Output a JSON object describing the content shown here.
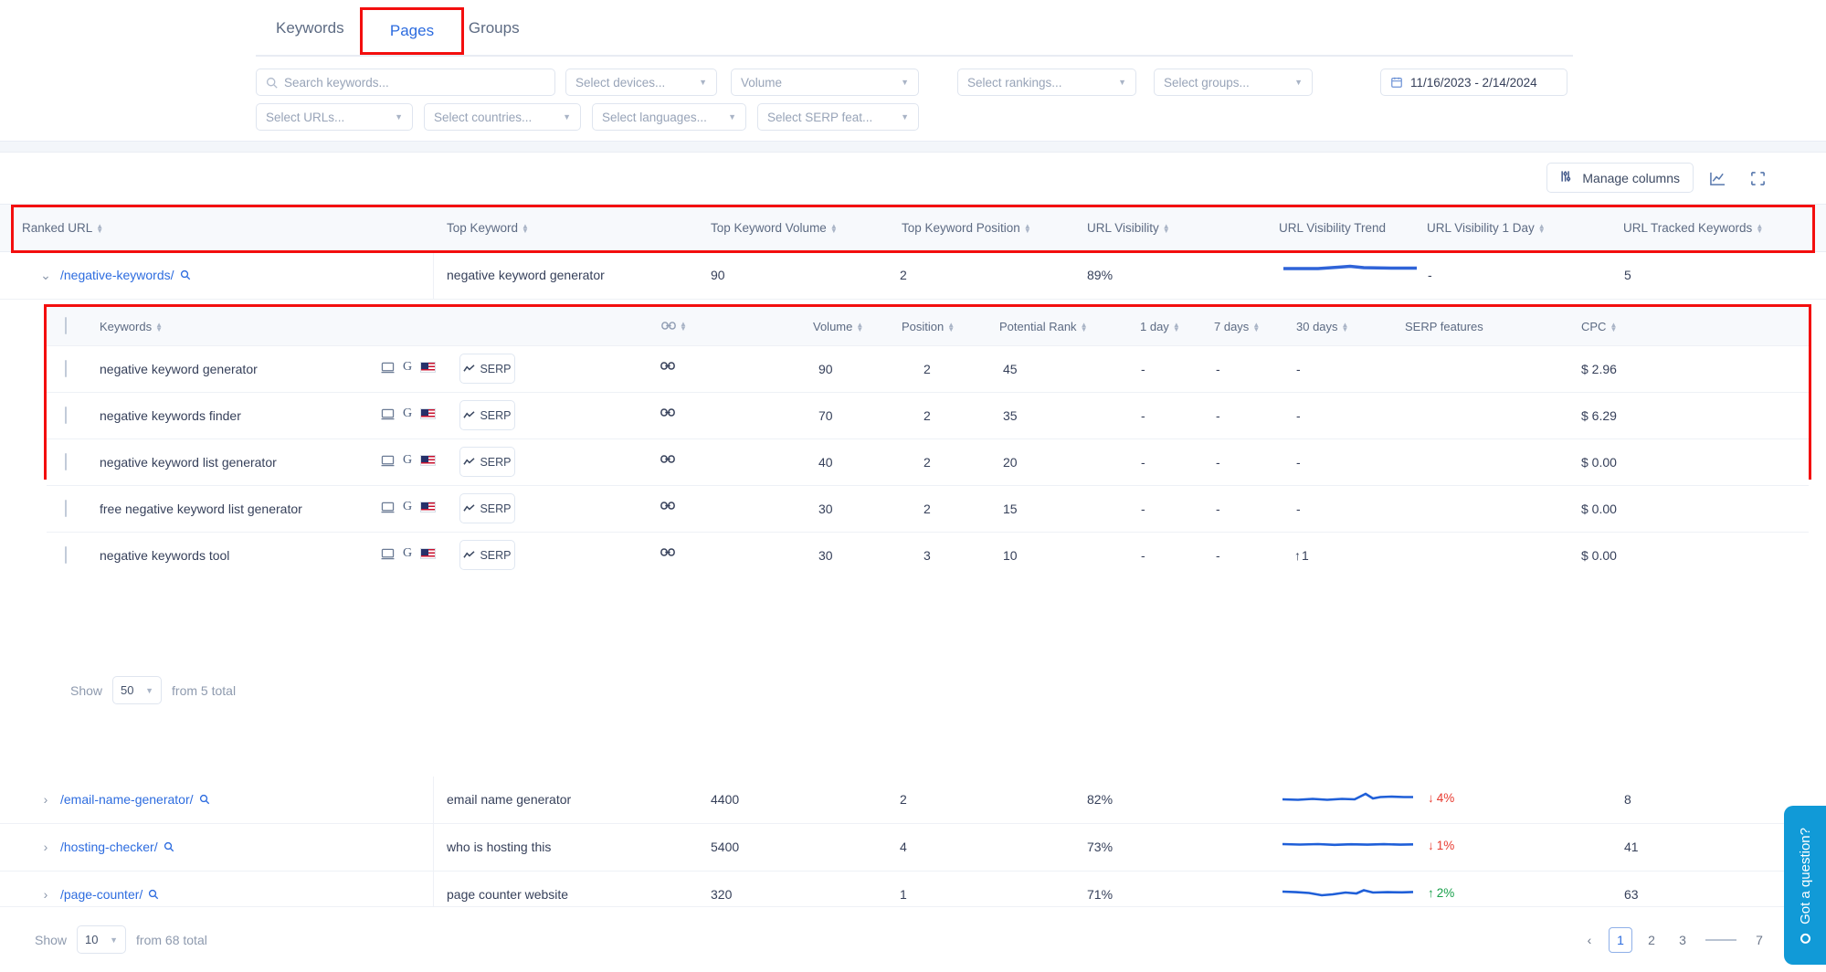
{
  "tabs": [
    {
      "label": "Keywords",
      "active": false
    },
    {
      "label": "Pages",
      "active": true
    },
    {
      "label": "Groups",
      "active": false
    }
  ],
  "filters": {
    "search_placeholder": "Search keywords...",
    "devices": "Select devices...",
    "volume": "Volume",
    "rankings": "Select rankings...",
    "groups": "Select groups...",
    "date_range": "11/16/2023 - 2/14/2024",
    "urls": "Select URLs...",
    "countries": "Select countries...",
    "languages": "Select languages...",
    "serp_features": "Select SERP feat..."
  },
  "toolbar": {
    "manage_columns": "Manage columns"
  },
  "outer_table": {
    "columns": [
      "Ranked URL",
      "Top Keyword",
      "Top Keyword Volume",
      "Top Keyword Position",
      "URL Visibility",
      "URL Visibility Trend",
      "URL Visibility 1 Day",
      "URL Tracked Keywords"
    ],
    "rows": [
      {
        "url": "/negative-keywords/",
        "top_keyword": "negative keyword generator",
        "volume": "90",
        "position": "2",
        "visibility": "89%",
        "visibility_1day": "-",
        "tracked_keywords": "5",
        "expanded": true
      },
      {
        "url": "/email-name-generator/",
        "top_keyword": "email name generator",
        "volume": "4400",
        "position": "2",
        "visibility": "82%",
        "visibility_1day": "4%",
        "trend_dir": "down",
        "tracked_keywords": "8",
        "expanded": false
      },
      {
        "url": "/hosting-checker/",
        "top_keyword": "who is hosting this",
        "volume": "5400",
        "position": "4",
        "visibility": "73%",
        "visibility_1day": "1%",
        "trend_dir": "down",
        "tracked_keywords": "41",
        "expanded": false
      },
      {
        "url": "/page-counter/",
        "top_keyword": "page counter website",
        "volume": "320",
        "position": "1",
        "visibility": "71%",
        "visibility_1day": "2%",
        "trend_dir": "up",
        "tracked_keywords": "63",
        "expanded": false
      }
    ]
  },
  "nested_table": {
    "columns": [
      "Keywords",
      "link",
      "Volume",
      "Position",
      "Potential Rank",
      "1 day",
      "7 days",
      "30 days",
      "SERP features",
      "CPC"
    ],
    "serp_button_label": "SERP",
    "rows": [
      {
        "keyword": "negative keyword generator",
        "volume": "90",
        "position": "2",
        "potential_rank": "45",
        "d1": "-",
        "d7": "-",
        "d30": "-",
        "d30_dir": "none",
        "serp_features": "",
        "cpc": "$ 2.96"
      },
      {
        "keyword": "negative keywords finder",
        "volume": "70",
        "position": "2",
        "potential_rank": "35",
        "d1": "-",
        "d7": "-",
        "d30": "-",
        "d30_dir": "none",
        "serp_features": "",
        "cpc": "$ 6.29"
      },
      {
        "keyword": "negative keyword list generator",
        "volume": "40",
        "position": "2",
        "potential_rank": "20",
        "d1": "-",
        "d7": "-",
        "d30": "-",
        "d30_dir": "none",
        "serp_features": "",
        "cpc": "$ 0.00"
      },
      {
        "keyword": "free negative keyword list generator",
        "volume": "30",
        "position": "2",
        "potential_rank": "15",
        "d1": "-",
        "d7": "-",
        "d30": "-",
        "d30_dir": "none",
        "serp_features": "",
        "cpc": "$ 0.00"
      },
      {
        "keyword": "negative keywords tool",
        "volume": "30",
        "position": "3",
        "potential_rank": "10",
        "d1": "-",
        "d7": "-",
        "d30": "1",
        "d30_dir": "up",
        "serp_features": "",
        "cpc": "$ 0.00"
      }
    ],
    "footer": {
      "show_label": "Show",
      "page_size": "50",
      "total_label": "from 5 total"
    }
  },
  "footer": {
    "show_label": "Show",
    "page_size": "10",
    "total_label": "from 68 total",
    "pages": [
      "1",
      "2",
      "3",
      "7"
    ],
    "current_page": "1"
  },
  "chat": {
    "label": "Got a question?"
  },
  "colors": {
    "accent_blue": "#2d6cdf",
    "highlight_red": "#f30e0e",
    "up_green": "#19a04b",
    "down_red": "#e8392e",
    "chat_blue": "#119ad7"
  }
}
